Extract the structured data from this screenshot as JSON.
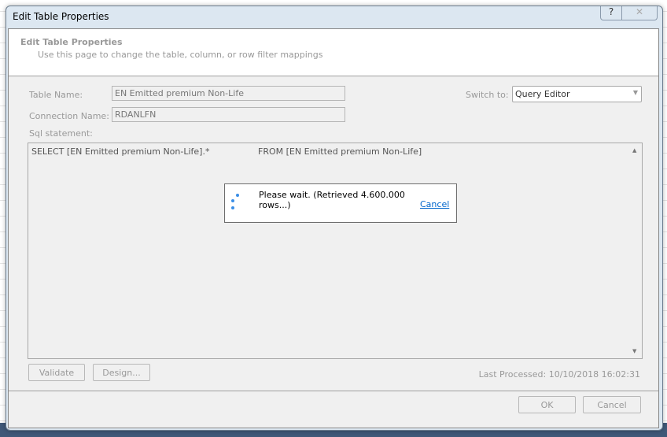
{
  "window": {
    "title": "Edit Table Properties",
    "help": "?",
    "close": "✕"
  },
  "header": {
    "title": "Edit Table Properties",
    "subtitle": "Use this page to change the table, column, or row filter mappings"
  },
  "form": {
    "table_name_label": "Table Name:",
    "table_name": "EN Emitted premium Non-Life",
    "connection_label": "Connection Name:",
    "connection": "RDANLFN",
    "switch_label": "Switch to:",
    "switch_value": "Query Editor",
    "sql_label": "Sql statement:",
    "sql_select": "SELECT [EN Emitted premium Non-Life].*",
    "sql_from": "FROM [EN Emitted premium Non-Life]"
  },
  "progress": {
    "message": "Please wait. (Retrieved 4.600.000 rows...)",
    "cancel": "Cancel"
  },
  "buttons": {
    "validate": "Validate",
    "design": "Design...",
    "ok": "OK",
    "cancel": "Cancel"
  },
  "status": {
    "last_processed": "Last Processed: 10/10/2018 16:02:31"
  }
}
